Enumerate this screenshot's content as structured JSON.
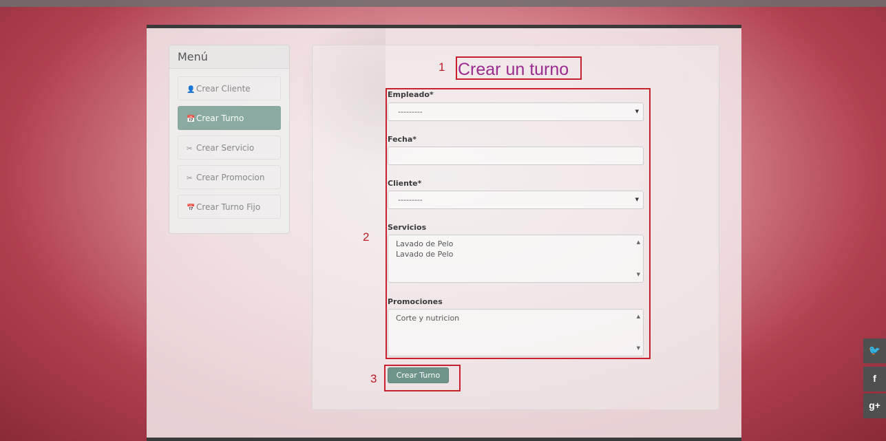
{
  "sidebar": {
    "title": "Menú",
    "items": [
      {
        "label": "Crear Cliente",
        "icon": "👤"
      },
      {
        "label": "Crear Turno",
        "icon": "📅"
      },
      {
        "label": "Crear Servicio",
        "icon": "✂"
      },
      {
        "label": "Crear Promocion",
        "icon": "✂"
      },
      {
        "label": "Crear Turno Fijo",
        "icon": "📅"
      }
    ],
    "active_index": 1
  },
  "annotations": [
    "1",
    "2",
    "3"
  ],
  "form": {
    "title": "Crear un turno",
    "empleado_label": "Empleado*",
    "empleado_value": "---------",
    "fecha_label": "Fecha*",
    "fecha_value": "",
    "cliente_label": "Cliente*",
    "cliente_value": "---------",
    "servicios_label": "Servicios",
    "servicios_options": [
      "Lavado de Pelo",
      "Lavado de Pelo"
    ],
    "promociones_label": "Promociones",
    "promociones_options": [
      "Corte y nutricion"
    ],
    "submit_label": "Crear Turno"
  },
  "social": {
    "twitter": "🐦",
    "facebook": "f",
    "google_plus": "g+"
  },
  "colors": {
    "annotation": "#c8202a",
    "title": "#9a2b8f",
    "accent": "#8aa9a0"
  }
}
